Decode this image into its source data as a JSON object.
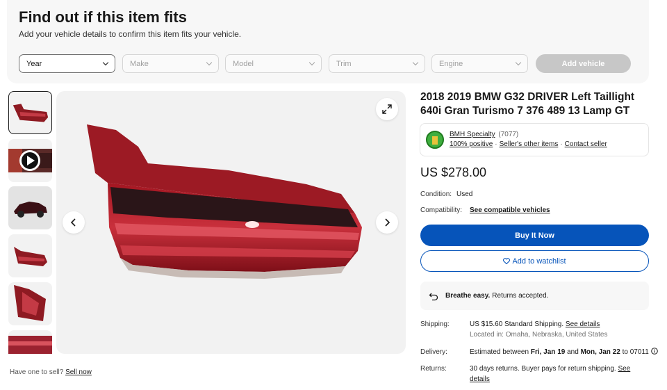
{
  "fitment": {
    "title": "Find out if this item fits",
    "subtitle": "Add your vehicle details to confirm this item fits your vehicle.",
    "selects": [
      "Year",
      "Make",
      "Model",
      "Trim",
      "Engine"
    ],
    "add_vehicle_label": "Add vehicle"
  },
  "gallery": {
    "sell_prompt": "Have one to sell?",
    "sell_link": "Sell now"
  },
  "listing": {
    "title": "2018 2019 BMW G32 DRIVER Left Taillight 640i Gran Turismo 7 376 489 13 Lamp GT",
    "seller": {
      "name": "BMH Specialty",
      "feedback_count": "(7077)",
      "positive": "100% positive",
      "other_items": "Seller's other items",
      "contact": "Contact seller"
    },
    "price": "US $278.00",
    "condition_label": "Condition:",
    "condition_value": "Used",
    "compat_label": "Compatibility:",
    "compat_link": "See compatible vehicles",
    "buy_label": "Buy It Now",
    "watch_label": "Add to watchlist",
    "returns_banner_bold": "Breathe easy.",
    "returns_banner_text": "Returns accepted.",
    "shipping_label": "Shipping:",
    "shipping_price": "US $15.60",
    "shipping_type": "Standard Shipping.",
    "shipping_details_link": "See details",
    "location": "Located in: Omaha, Nebraska, United States",
    "delivery_label": "Delivery:",
    "delivery_prefix": "Estimated between",
    "delivery_start": "Fri, Jan 19",
    "delivery_and": "and",
    "delivery_end": "Mon, Jan 22",
    "delivery_to": "to 07011",
    "returns_label": "Returns:",
    "returns_text": "30 days returns. Buyer pays for return shipping.",
    "returns_link": "See details"
  }
}
